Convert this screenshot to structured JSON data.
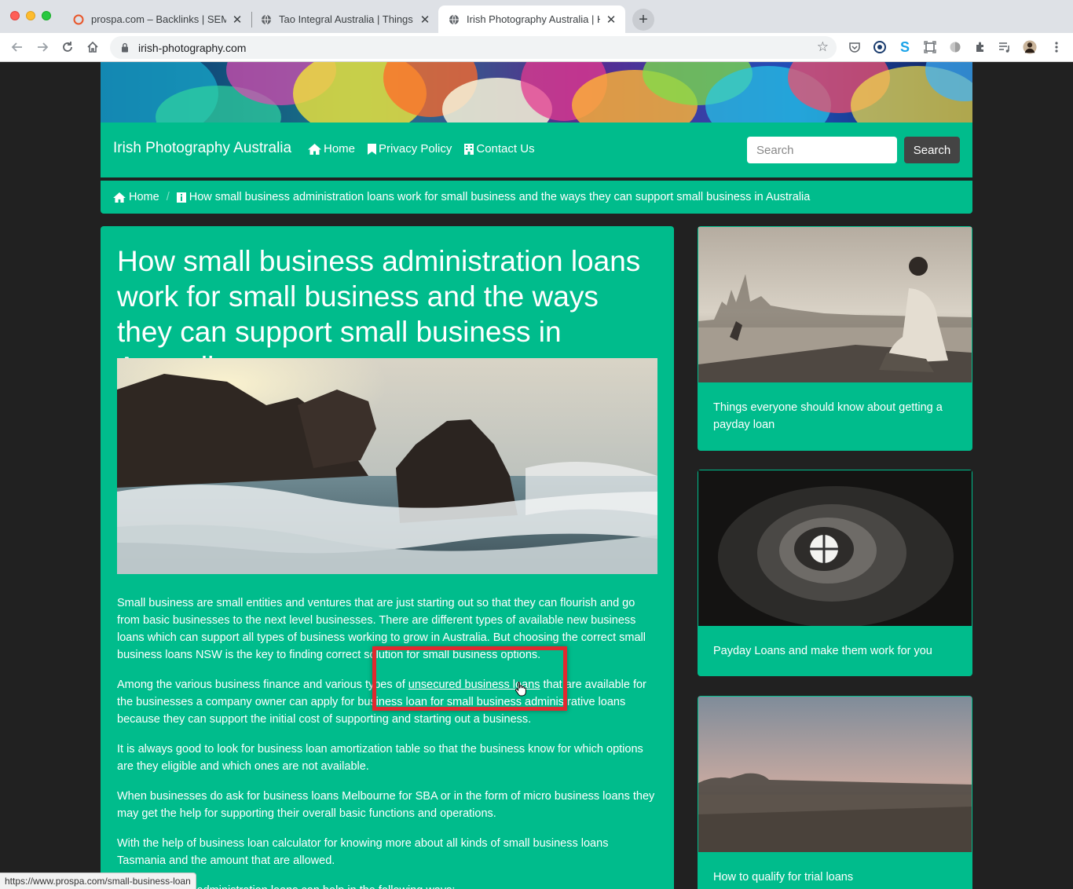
{
  "browser": {
    "tabs": [
      {
        "title": "prospa.com – Backlinks | SEMrush",
        "active": false
      },
      {
        "title": "Tao Integral Australia | Things to",
        "active": false
      },
      {
        "title": "Irish Photography Australia | How",
        "active": true
      }
    ],
    "url": "irish-photography.com",
    "status_url": "https://www.prospa.com/small-business-loan"
  },
  "site": {
    "brand": "Irish Photography Australia",
    "nav": [
      {
        "label": "Home",
        "icon": "home-icon"
      },
      {
        "label": "Privacy Policy",
        "icon": "bookmark-icon"
      },
      {
        "label": "Contact Us",
        "icon": "building-icon"
      }
    ],
    "search": {
      "placeholder": "Search",
      "button": "Search"
    },
    "colors": {
      "primary": "#00bc8c",
      "background": "#212121",
      "button": "#444444",
      "highlight": "#e0292f"
    }
  },
  "breadcrumb": {
    "home": "Home",
    "current": "How small business administration loans work for small business and the ways they can support small business in Australia"
  },
  "article": {
    "title": "How small business administration loans work for small business and the ways they can support small business in Australia",
    "p1": "Small business are small entities and ventures that are just starting out so that they can flourish and go from basic businesses to the next level businesses. There are different types of available new business loans which can support all types of business working to grow in Australia. But choosing the correct small business loans NSW is the key to finding correct solution for small business options.",
    "p2_before": "Among the various business finance and various types of ",
    "p2_link": "unsecured business loans",
    "p2_after": " that are available for the businesses a company owner can apply for business loan for small business administrative loans because they can support the initial cost of supporting and starting out a business.",
    "p3": "It is always good to look for business loan amortization table so that the business know for which options are they eligible and which ones are not available.",
    "p4": "When businesses do ask for business loans Melbourne for SBA or in the form of micro business loans they may get the help for supporting their overall basic functions and operations.",
    "p5": "With the help of business loan calculator for knowing more about all kinds of small business loans Tasmania and the amount that are allowed.",
    "p6": "Small business administration loans can help in the following ways:"
  },
  "sidebar": [
    {
      "caption": "Things everyone should know about getting a payday loan"
    },
    {
      "caption": "Payday Loans and make them work for you"
    },
    {
      "caption": "How to qualify for trial loans"
    }
  ]
}
